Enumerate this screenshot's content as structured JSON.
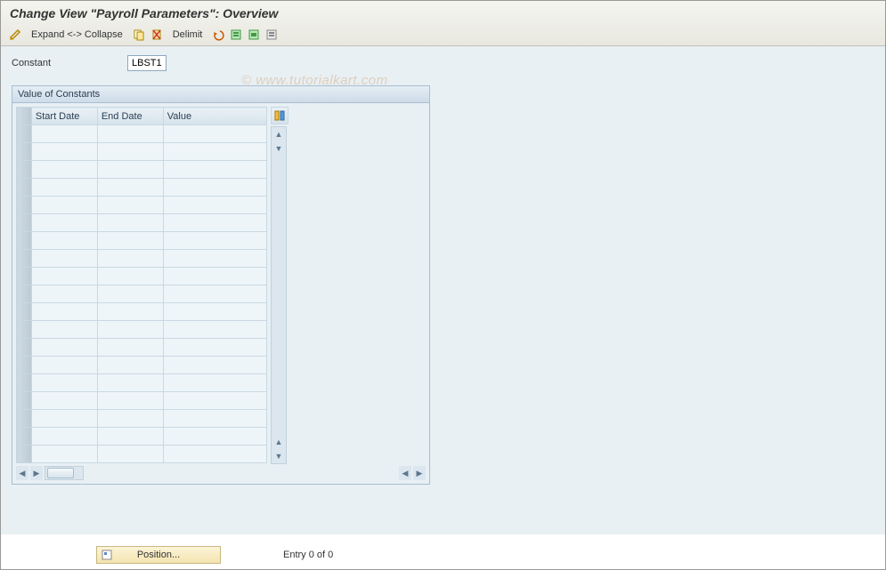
{
  "title": "Change View \"Payroll Parameters\": Overview",
  "toolbar": {
    "expand_collapse": "Expand <-> Collapse",
    "delimit": "Delimit"
  },
  "constant": {
    "label": "Constant",
    "value": "LBST1"
  },
  "panel": {
    "title": "Value of Constants",
    "columns": {
      "start": "Start Date",
      "end": "End Date",
      "value": "Value"
    }
  },
  "footer": {
    "position": "Position...",
    "entry": "Entry 0 of 0"
  },
  "watermark": "© www.tutorialkart.com"
}
